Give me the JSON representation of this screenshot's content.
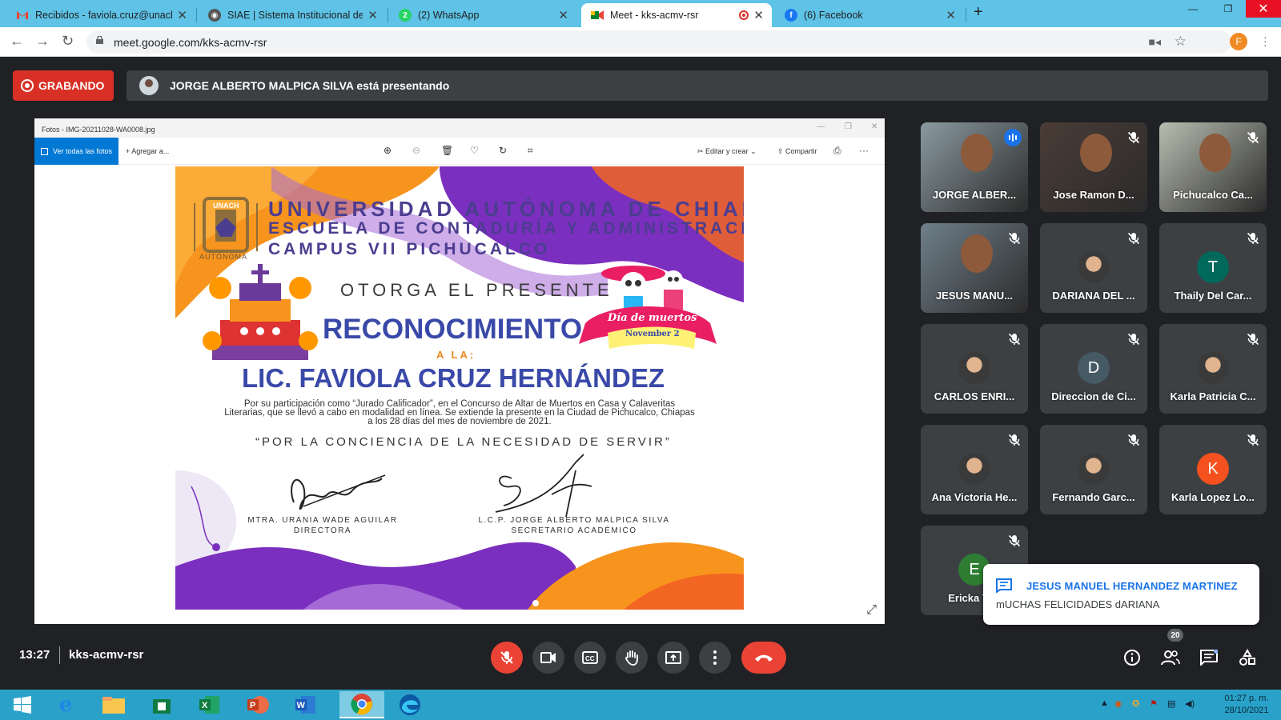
{
  "browser": {
    "tabs": [
      {
        "title": "Recibidos - faviola.cruz@unach.m",
        "icon": "gmail-icon"
      },
      {
        "title": "SIAE | Sistema Institucional de Ad",
        "icon": "siae-icon"
      },
      {
        "title": "(2) WhatsApp",
        "icon": "whatsapp-icon"
      },
      {
        "title": "Meet - kks-acmv-rsr",
        "icon": "meet-icon"
      },
      {
        "title": "(6) Facebook",
        "icon": "facebook-icon"
      }
    ],
    "active_tab": 3,
    "url": "meet.google.com/kks-acmv-rsr",
    "profile_initial": "F"
  },
  "meet": {
    "recording_label": "GRABANDO",
    "presenting_text": "JORGE ALBERTO MALPICA SILVA está presentando",
    "time": "13:27",
    "meeting_code": "kks-acmv-rsr",
    "participant_count": "20",
    "colors": {
      "accent": "#1a73e8",
      "danger": "#ea4335",
      "tile": "#3c4043"
    }
  },
  "photos_app": {
    "window_title": "Fotos - IMG-20211028-WA0008.jpg",
    "all_photos": "Ver todas las fotos",
    "add": "Agregar a...",
    "edit_create": "Editar y crear",
    "share": "Compartir"
  },
  "certificate": {
    "line1": "UNIVERSIDAD AUTÓNOMA DE CHIAPAS",
    "line2": "ESCUELA DE CONTADURÍA Y ADMINISTRACIÓN",
    "line3": "CAMPUS VII PICHUCALCO",
    "logo_text": "UNACH",
    "logo_sub": "AUTÓNOMA",
    "otorga": "OTORGA EL PRESENTE",
    "title": "RECONOCIMIENTO",
    "ala": "A LA:",
    "name": "LIC. FAVIOLA CRUZ HERNÁNDEZ",
    "body": "Por su participación como “Jurado Calificador”, en el Concurso de Altar de Muertos en Casa y Calaveritas Literarias, que se llevó a cabo en modalidad en línea. Se extiende la presente en la Ciudad de Pichucalco, Chiapas a los 28 días del mes de noviembre de 2021.",
    "motto": "“POR LA CONCIENCIA DE LA NECESIDAD DE SERVIR”",
    "dia_title": "Día de muertos",
    "dia_date": "November 2",
    "sig1_name": "MTRA. URANIA WADE AGUILAR",
    "sig1_role": "DIRECTORA",
    "sig2_name": "L.C.P. JORGE ALBERTO MALPICA SILVA",
    "sig2_role": "SECRETARIO ACADÉMICO"
  },
  "participants": [
    {
      "name": "JORGE ALBER...",
      "speaking": true,
      "type": "video"
    },
    {
      "name": "Jose Ramon D...",
      "type": "video"
    },
    {
      "name": "Pichucalco Ca...",
      "type": "video"
    },
    {
      "name": "JESUS MANU...",
      "type": "video"
    },
    {
      "name": "DARIANA DEL ...",
      "type": "photo"
    },
    {
      "name": "Thaily Del Car...",
      "type": "letter",
      "initial": "T",
      "color": "#00695c"
    },
    {
      "name": "CARLOS ENRI...",
      "type": "photo"
    },
    {
      "name": "Direccion de Ci...",
      "type": "letter",
      "initial": "D",
      "color": "#455a64"
    },
    {
      "name": "Karla Patricia C...",
      "type": "photo"
    },
    {
      "name": "Ana Victoria He...",
      "type": "photo"
    },
    {
      "name": "Fernando Garc...",
      "type": "photo"
    },
    {
      "name": "Karla Lopez Lo...",
      "type": "letter",
      "initial": "K",
      "color": "#f4511e"
    },
    {
      "name": "Ericka Yan",
      "type": "letter",
      "initial": "E",
      "color": "#2e7d32"
    }
  ],
  "chat_toast": {
    "sender": "JESUS MANUEL HERNANDEZ MARTINEZ",
    "message": "mUCHAS FELICIDADES dARIANA"
  },
  "taskbar": {
    "time": "01:27 p. m.",
    "date": "28/10/2021",
    "apps": [
      "start-icon",
      "ie-icon",
      "explorer-icon",
      "store-icon",
      "excel-icon",
      "powerpoint-icon",
      "word-icon",
      "chrome-icon",
      "edge-icon"
    ]
  }
}
